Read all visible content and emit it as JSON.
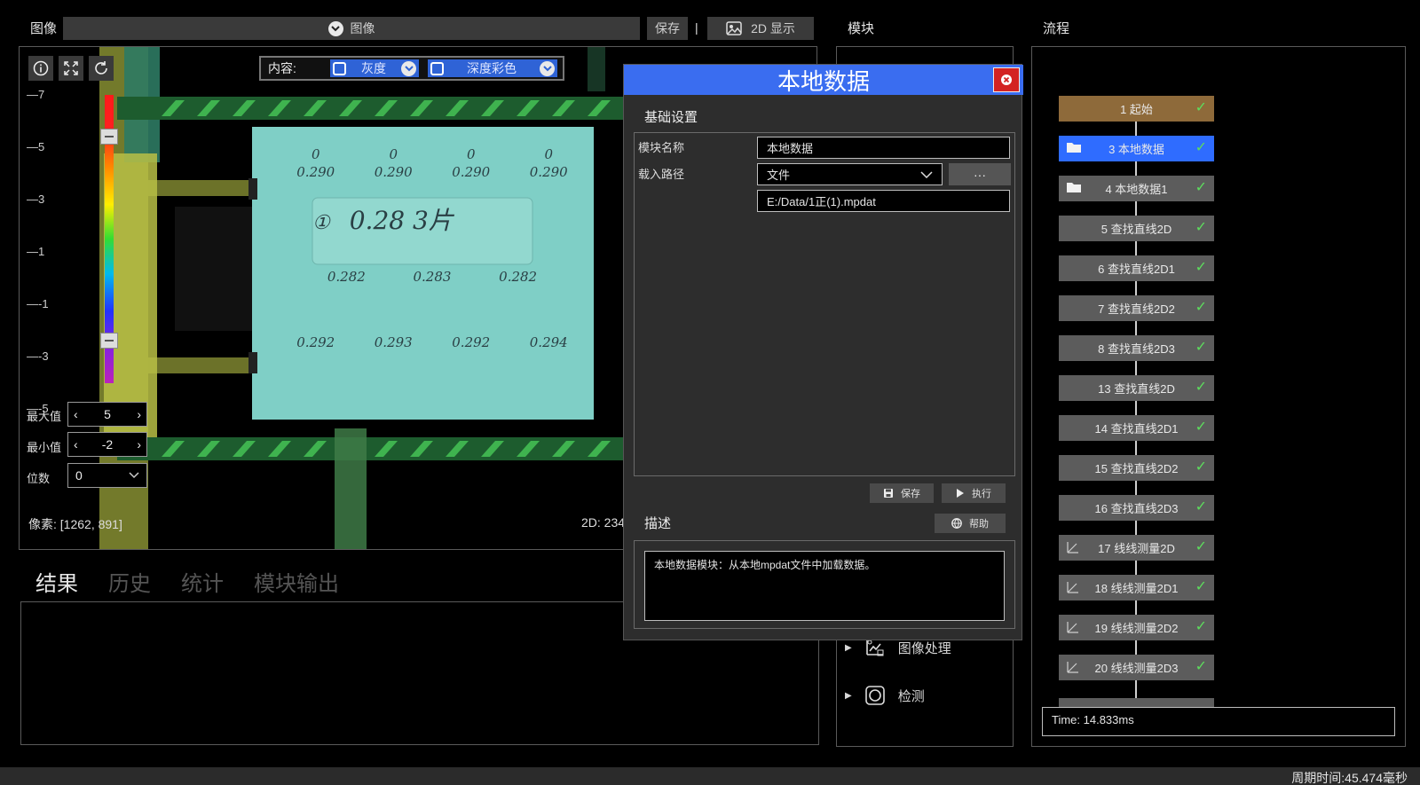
{
  "image_panel": {
    "title": "图像",
    "source_selector": "图像",
    "save_label": "保存",
    "separator": "|",
    "display_label": "2D 显示"
  },
  "module_panel": {
    "title": "模块"
  },
  "flow_panel": {
    "title": "流程"
  },
  "toolbar": {
    "content_label": "内容:",
    "gray_label": "灰度",
    "depth_label": "深度彩色"
  },
  "scale_ticks": [
    "7",
    "5",
    "3",
    "1",
    "-1",
    "-3",
    "-5"
  ],
  "range": {
    "max_label": "最大值",
    "max_value": "5",
    "min_label": "最小值",
    "min_value": "-2",
    "digits_label": "位数",
    "digits_value": "0"
  },
  "status": {
    "pixel": "像素: [1262, 891]",
    "coord_2d": "2D: 234,"
  },
  "scene_text": {
    "r1": [
      "0",
      "0",
      "0",
      "0"
    ],
    "r1b": [
      "0.290",
      "0.290",
      "0.290",
      "0.290"
    ],
    "note_big": "0.28  3片",
    "note_circle": "①",
    "r2": [
      "0.282",
      "0.283",
      "0.282"
    ],
    "r3": [
      "0.292",
      "0.293",
      "0.292",
      "0.294"
    ]
  },
  "result_tabs": [
    "结果",
    "历史",
    "统计",
    "模块输出"
  ],
  "dialog": {
    "title": "本地数据",
    "section_basic": "基础设置",
    "name_label": "模块名称",
    "name_value": "本地数据",
    "path_label": "载入路径",
    "path_type": "文件",
    "browse_label": "···",
    "path_value": "E:/Data/1正(1).mpdat",
    "save_label": "保存",
    "run_label": "执行",
    "desc_title": "描述",
    "help_label": "帮助",
    "desc_text": "本地数据模块：从本地mpdat文件中加载数据。"
  },
  "module_tree": [
    {
      "label": "图像处理",
      "icon": "image-processing-icon"
    },
    {
      "label": "检测",
      "icon": "detection-icon"
    }
  ],
  "flow": {
    "nodes": [
      {
        "label": "1 起始",
        "state": "start",
        "icon": ""
      },
      {
        "label": "3 本地数据",
        "state": "selected",
        "icon": "folder-icon"
      },
      {
        "label": "4 本地数据1",
        "state": "normal",
        "icon": "folder-icon"
      },
      {
        "label": "5 查找直线2D",
        "state": "normal",
        "icon": ""
      },
      {
        "label": "6 查找直线2D1",
        "state": "normal",
        "icon": ""
      },
      {
        "label": "7 查找直线2D2",
        "state": "normal",
        "icon": ""
      },
      {
        "label": "8 查找直线2D3",
        "state": "normal",
        "icon": ""
      },
      {
        "label": "13 查找直线2D",
        "state": "normal",
        "icon": ""
      },
      {
        "label": "14 查找直线2D1",
        "state": "normal",
        "icon": ""
      },
      {
        "label": "15 查找直线2D2",
        "state": "normal",
        "icon": ""
      },
      {
        "label": "16 查找直线2D3",
        "state": "normal",
        "icon": ""
      },
      {
        "label": "17 线线测量2D",
        "state": "normal",
        "icon": "measure-icon"
      },
      {
        "label": "18 线线测量2D1",
        "state": "normal",
        "icon": "measure-icon"
      },
      {
        "label": "19 线线测量2D2",
        "state": "normal",
        "icon": "measure-icon"
      },
      {
        "label": "20 线线测量2D3",
        "state": "normal",
        "icon": "measure-icon"
      }
    ],
    "time": "Time: 14.833ms"
  },
  "footer": {
    "cycle_time": "周期时间:45.474毫秒"
  },
  "colors": {
    "accent": "#3a6df0",
    "start_node": "#8e6a3a",
    "selected_node": "#2f6cff",
    "check": "#5ddc5d",
    "close": "#d32323"
  }
}
